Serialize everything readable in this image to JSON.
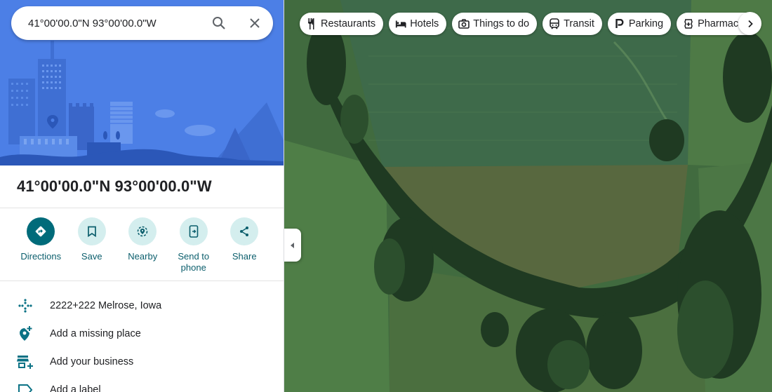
{
  "search": {
    "value": "41°00'00.0\"N 93°00'00.0\"W"
  },
  "place": {
    "title": "41°00'00.0\"N 93°00'00.0\"W"
  },
  "actions": [
    {
      "label": "Directions",
      "icon": "directions-icon"
    },
    {
      "label": "Save",
      "icon": "bookmark-icon"
    },
    {
      "label": "Nearby",
      "icon": "nearby-icon"
    },
    {
      "label": "Send to phone",
      "icon": "send-to-phone-icon"
    },
    {
      "label": "Share",
      "icon": "share-icon"
    }
  ],
  "info": [
    {
      "text": "2222+222 Melrose, Iowa",
      "icon": "plus-code-icon"
    },
    {
      "text": "Add a missing place",
      "icon": "add-place-icon"
    },
    {
      "text": "Add your business",
      "icon": "add-business-icon"
    },
    {
      "text": "Add a label",
      "icon": "label-icon"
    }
  ],
  "chips": [
    {
      "label": "Restaurants",
      "icon": "restaurant-icon"
    },
    {
      "label": "Hotels",
      "icon": "hotel-icon"
    },
    {
      "label": "Things to do",
      "icon": "camera-icon"
    },
    {
      "label": "Transit",
      "icon": "transit-icon"
    },
    {
      "label": "Parking",
      "icon": "parking-icon"
    },
    {
      "label": "Pharmac",
      "icon": "pharmacy-icon"
    }
  ],
  "colors": {
    "accent": "#006b7a",
    "action_bg": "#d4eeee",
    "hero_bg": "#4c7fe6",
    "marker": "#ea4335"
  }
}
